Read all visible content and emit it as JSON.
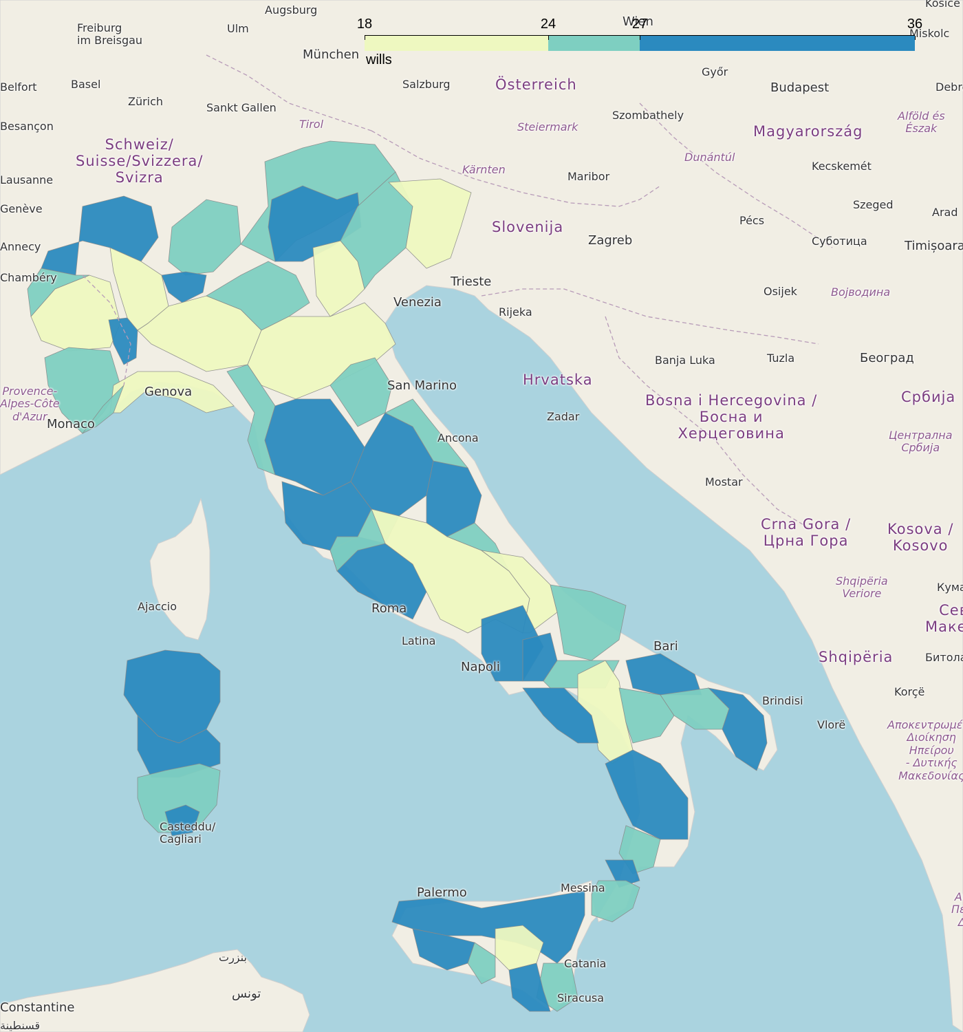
{
  "map": {
    "color_bins": [
      {
        "from": 18,
        "to": 24,
        "color": "#eef8c0"
      },
      {
        "from": 24,
        "to": 27,
        "color": "#7ecfc1"
      },
      {
        "from": 27,
        "to": 36,
        "color": "#2b8abf"
      }
    ],
    "border_color": "#8a8a8a"
  },
  "legend": {
    "caption": "wills",
    "ticks": [
      "18",
      "24",
      "27",
      "36"
    ]
  },
  "places": [
    {
      "name": "Augsburg",
      "kind": "town"
    },
    {
      "name": "Freiburg\nim Breisgau",
      "kind": "town"
    },
    {
      "name": "Ulm",
      "kind": "town"
    },
    {
      "name": "München",
      "kind": "city"
    },
    {
      "name": "Wien",
      "kind": "city"
    },
    {
      "name": "Miskolc",
      "kind": "town"
    },
    {
      "name": "Košice",
      "kind": "town"
    },
    {
      "name": "Belfort",
      "kind": "town"
    },
    {
      "name": "Basel",
      "kind": "town"
    },
    {
      "name": "Zürich",
      "kind": "town"
    },
    {
      "name": "Sankt Gallen",
      "kind": "town"
    },
    {
      "name": "Salzburg",
      "kind": "town"
    },
    {
      "name": "Österreich",
      "kind": "country"
    },
    {
      "name": "Győr",
      "kind": "town"
    },
    {
      "name": "Budapest",
      "kind": "city"
    },
    {
      "name": "Debrecen",
      "kind": "town"
    },
    {
      "name": "Besançon",
      "kind": "town"
    },
    {
      "name": "Tirol",
      "kind": "region"
    },
    {
      "name": "Szombathely",
      "kind": "town"
    },
    {
      "name": "Alföld és\nÉszak",
      "kind": "region"
    },
    {
      "name": "Schweiz/\nSuisse/Svizzera/\nSvizra",
      "kind": "country"
    },
    {
      "name": "Steiermark",
      "kind": "region"
    },
    {
      "name": "Magyarország",
      "kind": "country"
    },
    {
      "name": "Dunántúl",
      "kind": "region"
    },
    {
      "name": "Kärnten",
      "kind": "region"
    },
    {
      "name": "Kecskemét",
      "kind": "town"
    },
    {
      "name": "Lausanne",
      "kind": "town"
    },
    {
      "name": "Maribor",
      "kind": "town"
    },
    {
      "name": "Szeged",
      "kind": "town"
    },
    {
      "name": "Genève",
      "kind": "town"
    },
    {
      "name": "Arad",
      "kind": "town"
    },
    {
      "name": "Slovenija",
      "kind": "country"
    },
    {
      "name": "Pécs",
      "kind": "town"
    },
    {
      "name": "Annecy",
      "kind": "town"
    },
    {
      "name": "Zagreb",
      "kind": "city"
    },
    {
      "name": "Суботица",
      "kind": "town"
    },
    {
      "name": "Timișoara",
      "kind": "city"
    },
    {
      "name": "Chambéry",
      "kind": "town"
    },
    {
      "name": "Trieste",
      "kind": "city"
    },
    {
      "name": "Venezia",
      "kind": "city"
    },
    {
      "name": "Osijek",
      "kind": "town"
    },
    {
      "name": "Војводина",
      "kind": "region"
    },
    {
      "name": "Rijeka",
      "kind": "town"
    },
    {
      "name": "Banja Luka",
      "kind": "town"
    },
    {
      "name": "Tuzla",
      "kind": "town"
    },
    {
      "name": "Београд",
      "kind": "city"
    },
    {
      "name": "Hrvatska",
      "kind": "country"
    },
    {
      "name": "Genova",
      "kind": "city"
    },
    {
      "name": "San Marino",
      "kind": "city"
    },
    {
      "name": "Bosna i Hercegovina /\nБосна и\nХерцеговина",
      "kind": "country"
    },
    {
      "name": "Србија",
      "kind": "country"
    },
    {
      "name": "Provence-\nAlpes-Côte\nd'Azur",
      "kind": "region"
    },
    {
      "name": "Zadar",
      "kind": "town"
    },
    {
      "name": "Monaco",
      "kind": "city"
    },
    {
      "name": "Ancona",
      "kind": "town"
    },
    {
      "name": "Централна\nСрбија",
      "kind": "region"
    },
    {
      "name": "Mostar",
      "kind": "town"
    },
    {
      "name": "Crna Gora /\nЦрна Гора",
      "kind": "country"
    },
    {
      "name": "Kosova /\nKosovo",
      "kind": "country"
    },
    {
      "name": "Shqipëria\nVeriore",
      "kind": "region"
    },
    {
      "name": "Ajaccio",
      "kind": "town"
    },
    {
      "name": "Roma",
      "kind": "city"
    },
    {
      "name": "Latina",
      "kind": "town"
    },
    {
      "name": "Bari",
      "kind": "city"
    },
    {
      "name": "Shqipëria",
      "kind": "country"
    },
    {
      "name": "Битола",
      "kind": "town"
    },
    {
      "name": "Napoli",
      "kind": "city"
    },
    {
      "name": "Brindisi",
      "kind": "town"
    },
    {
      "name": "Korçë",
      "kind": "town"
    },
    {
      "name": "Vlorë",
      "kind": "town"
    },
    {
      "name": "Αποκεντρωμένη\nΔιοίκηση\nΗπείρου\n- Δυτικής\nΜακεδονίας",
      "kind": "region"
    },
    {
      "name": "Casteddu/\nCagliari",
      "kind": "town"
    },
    {
      "name": "Palermo",
      "kind": "city"
    },
    {
      "name": "Messina",
      "kind": "town"
    },
    {
      "name": "Catania",
      "kind": "town"
    },
    {
      "name": "Siracusa",
      "kind": "town"
    },
    {
      "name": "بنزرت",
      "kind": "town"
    },
    {
      "name": "تونس",
      "kind": "city"
    },
    {
      "name": "Constantine",
      "kind": "city"
    },
    {
      "name": "قسنطينة",
      "kind": "town"
    },
    {
      "name": "Αποκ\nΠελοπ\nΔυτ",
      "kind": "region"
    },
    {
      "name": "Кумановo",
      "kind": "town"
    },
    {
      "name": "Северна\nМакедонија",
      "kind": "country"
    }
  ]
}
